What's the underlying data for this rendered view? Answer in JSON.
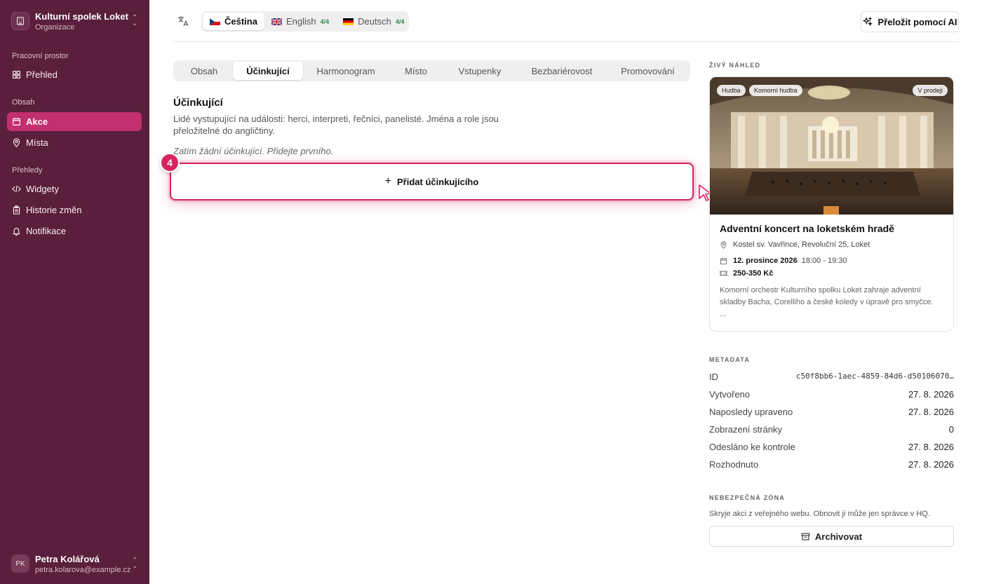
{
  "sidebar": {
    "org_name": "Kulturní spolek Loket",
    "org_sub": "Organizace",
    "section_workspace": "Pracovní prostor",
    "item_overview": "Přehled",
    "section_content": "Obsah",
    "item_events": "Akce",
    "item_places": "Místa",
    "section_reports": "Přehledy",
    "item_widgets": "Widgety",
    "item_history": "Historie změn",
    "item_notifications": "Notifikace",
    "user_initials": "PK",
    "user_name": "Petra Kolářová",
    "user_email": "petra.kolarova@example.cz"
  },
  "languages": {
    "cs": "Čeština",
    "en": "English",
    "en_count": "4/4",
    "de": "Deutsch",
    "de_count": "4/4"
  },
  "ai_button": "Přeložit pomocí AI",
  "tabs": [
    "Obsah",
    "Účinkující",
    "Harmonogram",
    "Místo",
    "Vstupenky",
    "Bezbariérovost",
    "Promovování"
  ],
  "section": {
    "title": "Účinkující",
    "description": "Lidé vystupující na události: herci, interpreti, řečníci, panelisté. Jména a role jsou přeložitelné do angličtiny.",
    "empty": "Zatím žádní účinkující. Přidejte prvního.",
    "add_button": "Přidat účinkujícího",
    "step": "4"
  },
  "preview": {
    "label": "ŽIVÝ NÁHLED",
    "chip_music": "Hudba",
    "chip_chamber": "Komorní hudba",
    "chip_sale": "V prodeji",
    "title": "Adventní koncert na loketském hradě",
    "place": "Kostel sv. Vavřince, Revoluční 25, Loket",
    "date": "12. prosince 2026",
    "time": "18:00 - 19:30",
    "price": "250-350 Kč",
    "description": "Komorní orchestr Kulturního spolku Loket zahraje adventní skladby Bacha, Corelliho a české koledy v úpravě pro smyčce.",
    "more": "..."
  },
  "metadata": {
    "label": "METADATA",
    "id_label": "ID",
    "id_value": "c50f8bb6-1aec-4859-84d6-d50106070…",
    "created_label": "Vytvořeno",
    "created_value": "27. 8. 2026",
    "updated_label": "Naposledy upraveno",
    "updated_value": "27. 8. 2026",
    "views_label": "Zobrazení stránky",
    "views_value": "0",
    "submitted_label": "Odesláno ke kontrole",
    "submitted_value": "27. 8. 2026",
    "decided_label": "Rozhodnuto",
    "decided_value": "27. 8. 2026"
  },
  "danger": {
    "label": "NEBEZPEČNÁ ZÓNA",
    "description": "Skryje akci z veřejného webu. Obnovit ji může jen správce v HQ.",
    "archive_button": "Archivovat"
  },
  "colors": {
    "sidebar_bg": "#5a1f3c",
    "accent": "#c2306f",
    "highlight": "#d6245f"
  }
}
